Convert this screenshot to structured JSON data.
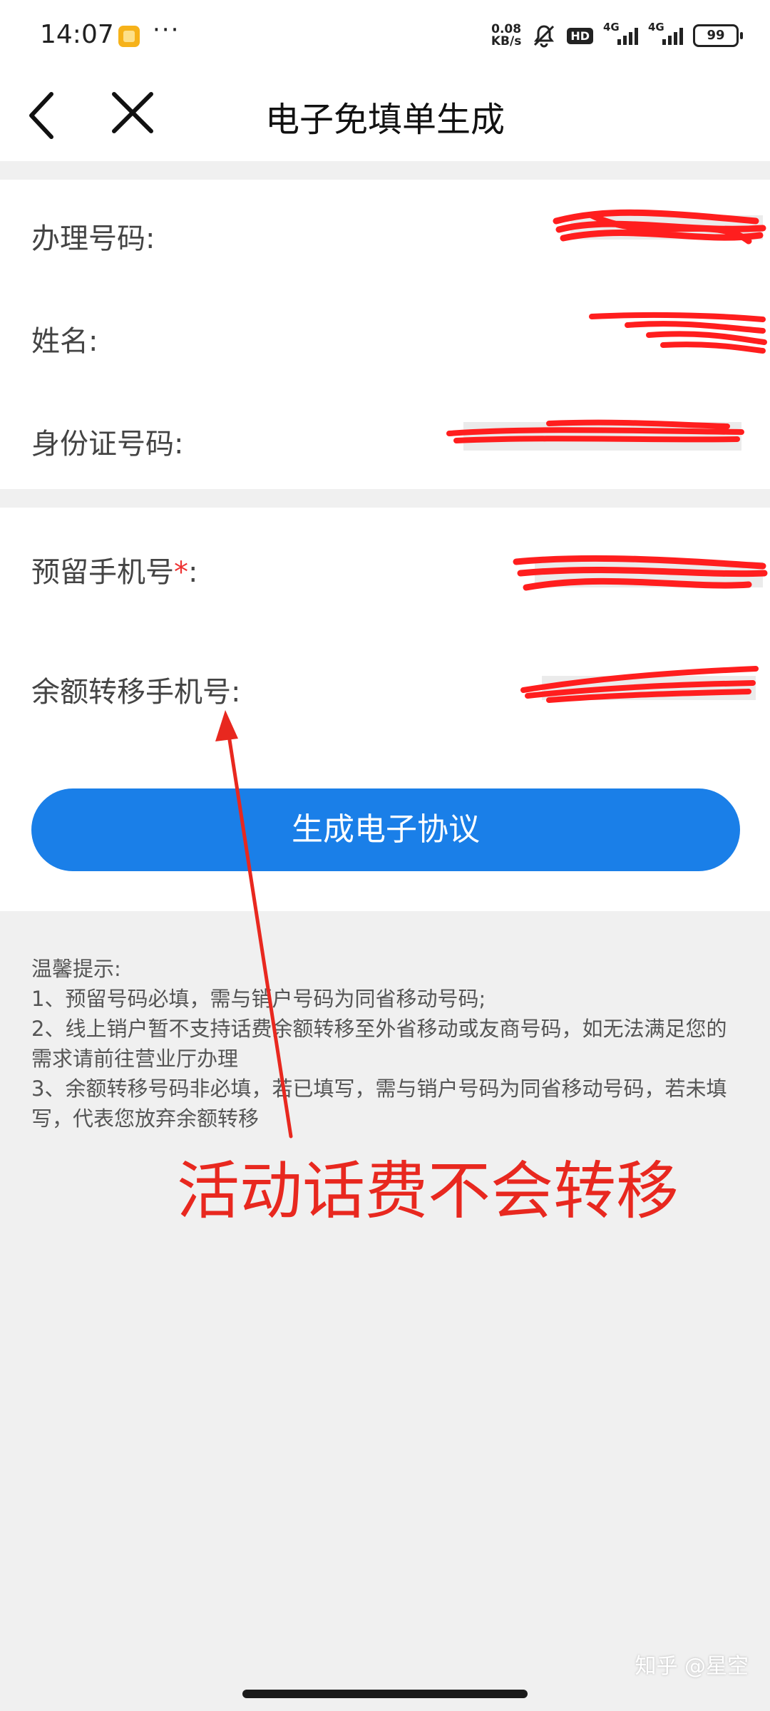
{
  "status_bar": {
    "time": "14:07",
    "more": "···",
    "net_speed_value": "0.08",
    "net_speed_unit": "KB/s",
    "hd_badge": "HD",
    "sim1_label": "4G",
    "sim2_label": "4G",
    "battery": "99"
  },
  "header": {
    "title": "电子免填单生成",
    "back_icon": "chevron-left-icon",
    "close_icon": "close-icon"
  },
  "form": {
    "section1": [
      {
        "label": "办理号码:"
      },
      {
        "label": "姓名:"
      },
      {
        "label": "身份证号码:"
      }
    ],
    "section2": {
      "reserved_phone_label": "预留手机号",
      "required_mark": "*",
      "reserved_phone_colon": ":",
      "transfer_phone_label": "余额转移手机号:"
    }
  },
  "submit_button": "生成电子协议",
  "tips": {
    "title": "温馨提示:",
    "items": [
      "1、预留号码必填，需与销户号码为同省移动号码;",
      "2、线上销户暂不支持话费余额转移至外省移动或友商号码，如无法满足您的需求请前往营业厅办理",
      "3、余额转移号码非必填，若已填写，需与销户号码为同省移动号码，若未填写，代表您放弃余额转移"
    ]
  },
  "annotation": {
    "text": "活动话费不会转移",
    "color": "#e8281f"
  },
  "watermark": "知乎 @星空",
  "colors": {
    "accent": "#1a7fe8",
    "scribble": "#ff1e1e",
    "background": "#f0f0f0"
  }
}
